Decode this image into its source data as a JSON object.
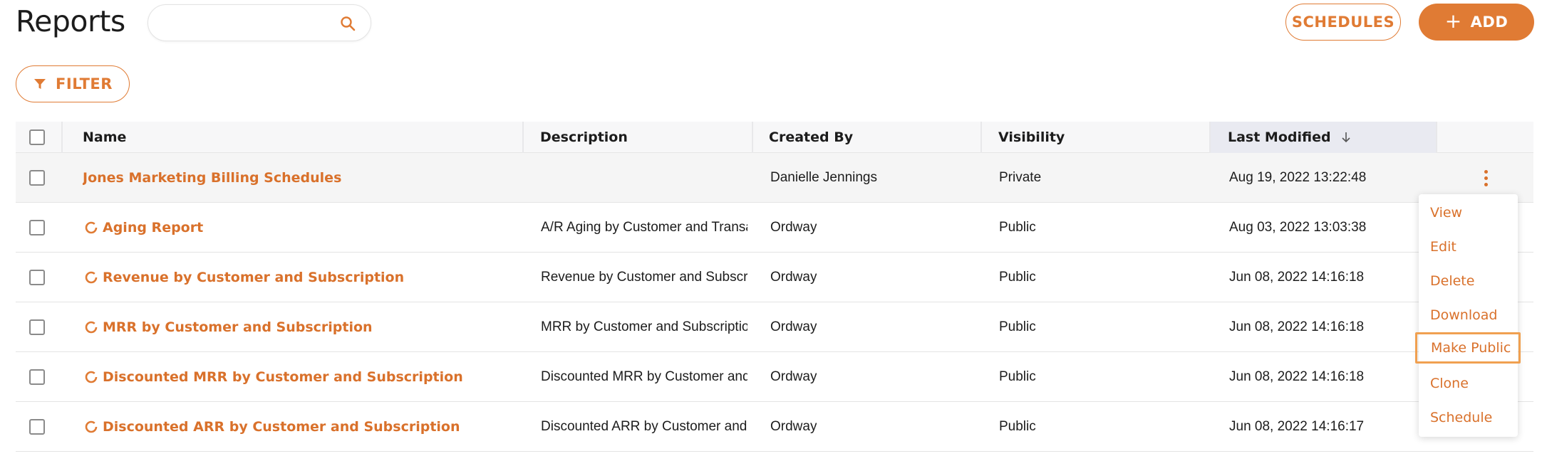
{
  "header": {
    "title": "Reports",
    "search_placeholder": "",
    "schedules_label": "SCHEDULES",
    "add_label": "ADD",
    "filter_label": "FILTER"
  },
  "table": {
    "columns": [
      "Name",
      "Description",
      "Created By",
      "Visibility",
      "Last Modified"
    ],
    "sort_column": "Last Modified",
    "sort_direction": "descending",
    "rows": [
      {
        "name": "Jones Marketing Billing Schedules",
        "description": "",
        "created_by": "Danielle Jennings",
        "visibility": "Private",
        "last_modified": "Aug 19, 2022 13:22:48"
      },
      {
        "name": "Aging Report",
        "description": "A/R Aging by Customer and Transa",
        "created_by": "Ordway",
        "visibility": "Public",
        "last_modified": "Aug 03, 2022 13:03:38"
      },
      {
        "name": "Revenue by Customer and Subscription",
        "description": "Revenue by Customer and Subscri",
        "created_by": "Ordway",
        "visibility": "Public",
        "last_modified": "Jun 08, 2022 14:16:18"
      },
      {
        "name": "MRR by Customer and Subscription",
        "description": "MRR by Customer and Subscriptio",
        "created_by": "Ordway",
        "visibility": "Public",
        "last_modified": "Jun 08, 2022 14:16:18"
      },
      {
        "name": "Discounted MRR by Customer and Subscription",
        "description": "Discounted MRR by Customer and",
        "created_by": "Ordway",
        "visibility": "Public",
        "last_modified": "Jun 08, 2022 14:16:18"
      },
      {
        "name": "Discounted ARR by Customer and Subscription",
        "description": "Discounted ARR by Customer and",
        "created_by": "Ordway",
        "visibility": "Public",
        "last_modified": "Jun 08, 2022 14:16:17"
      }
    ]
  },
  "row_menu": {
    "items": [
      "View",
      "Edit",
      "Delete",
      "Download",
      "Make Public",
      "Clone",
      "Schedule"
    ],
    "focused_item": "Make Public"
  },
  "colors": {
    "accent": "#e07b34",
    "link": "#d9712b",
    "header_bg": "#f7f7f8",
    "sorted_header_bg": "#e9eaf1",
    "highlight_row": "#f5f5f5"
  },
  "icons": {
    "search": "search-icon",
    "filter": "filter-icon",
    "add": "plus-icon",
    "sort": "arrow-down-icon",
    "row_status": "loading-ring-icon",
    "row_actions": "kebab-menu-icon"
  }
}
